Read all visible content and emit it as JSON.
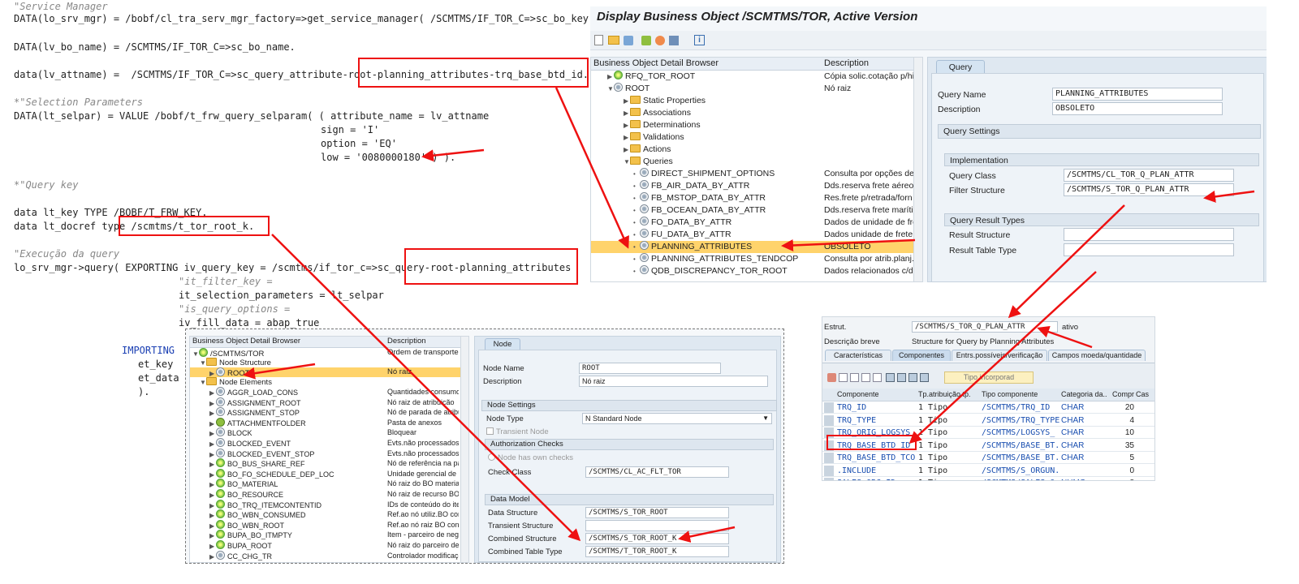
{
  "code": {
    "lines": [
      "\"Service Manager",
      "DATA(lo_srv_mgr) = /bobf/cl_tra_serv_mgr_factory=>get_service_manager( /SCMTMS/IF_TOR_C=>sc_bo_key ).",
      "DATA(lv_bo_name) = /SCMTMS/IF_TOR_C=>sc_bo_name.",
      "data(lv_attname) =  /SCMTMS/IF_TOR_C=>sc_query_attribute-root-planning_attributes-trq_base_btd_id.",
      "*\"Selection Parameters",
      "DATA(lt_selpar) = VALUE /bobf/t_frw_query_selparam( ( attribute_name = lv_attname",
      "sign = 'I'",
      "option = 'EQ'",
      "low = '0080000180' ) ).",
      "*\"Query key",
      "data lt_key TYPE /BOBF/T_FRW_KEY.",
      "data lt_docref type /scmtms/t_tor_root_k.",
      "\"Execução da query",
      "lo_srv_mgr->query( EXPORTING iv_query_key = /scmtms/if_tor_c=>sc_query-root-planning_attributes",
      "\"it_filter_key =",
      "it_selection_parameters = lt_selpar",
      "\"is_query_options =",
      "iv_fill_data = abap_true",
      "IMPORTING",
      "et_key",
      "et_data",
      ")."
    ]
  },
  "bo_window": {
    "title": "Display Business Object /SCMTMS/TOR, Active Version",
    "browser_header": "Business Object Detail Browser",
    "desc_header": "Description",
    "rows": [
      {
        "name": "RFQ_TOR_ROOT",
        "desc": "Cópia solic.cotação p/hier",
        "icon": "o"
      },
      {
        "name": "ROOT",
        "desc": "Nó raiz",
        "icon": "c"
      },
      {
        "name": "Static Properties",
        "desc": "",
        "icon": "f"
      },
      {
        "name": "Associations",
        "desc": "",
        "icon": "f"
      },
      {
        "name": "Determinations",
        "desc": "",
        "icon": "f"
      },
      {
        "name": "Validations",
        "desc": "",
        "icon": "f"
      },
      {
        "name": "Actions",
        "desc": "",
        "icon": "f"
      },
      {
        "name": "Queries",
        "desc": "",
        "icon": "f"
      },
      {
        "name": "DIRECT_SHIPMENT_OPTIONS",
        "desc": "Consulta por opções de r",
        "icon": "c"
      },
      {
        "name": "FB_AIR_DATA_BY_ATTR",
        "desc": "Dds.reserva frete aéreo p",
        "icon": "c"
      },
      {
        "name": "FB_MSTOP_DATA_BY_ATTR",
        "desc": "Res.frete p/retrada/forn",
        "icon": "c"
      },
      {
        "name": "FB_OCEAN_DATA_BY_ATTR",
        "desc": "Dds.reserva frete marítim",
        "icon": "c"
      },
      {
        "name": "FO_DATA_BY_ATTR",
        "desc": "Dados de unidade de fret",
        "icon": "c"
      },
      {
        "name": "FU_DATA_BY_ATTR",
        "desc": "Dados unidade de frete p",
        "icon": "c"
      },
      {
        "name": "PLANNING_ATTRIBUTES",
        "desc": "OBSOLETO",
        "icon": "c"
      },
      {
        "name": "PLANNING_ATTRIBUTES_TENDCOP",
        "desc": "Consulta por atrib.planj.-",
        "icon": "c"
      },
      {
        "name": "QDB_DISCREPANCY_TOR_ROOT",
        "desc": "Dados relacionados c/des",
        "icon": "c"
      }
    ],
    "tab": "Query",
    "query_name_label": "Query Name",
    "query_name_value": "PLANNING_ATTRIBUTES",
    "description_label": "Description",
    "description_value": "OBSOLETO",
    "settings_title": "Query Settings",
    "impl_title": "Implementation",
    "query_class_label": "Query Class",
    "query_class_value": "/SCMTMS/CL_TOR_Q_PLAN_ATTR",
    "filter_label": "Filter Structure",
    "filter_value": "/SCMTMS/S_TOR_Q_PLAN_ATTR",
    "result_title": "Query Result Types",
    "result_struct_label": "Result Structure",
    "result_table_label": "Result Table Type"
  },
  "node_window": {
    "browser_header": "Business Object Detail Browser",
    "desc_header": "Description",
    "root_label": "/SCMTMS/TOR",
    "root_desc": "Ordem de transporte",
    "node_structure": "Node Structure",
    "node_elements": "Node Elements",
    "rows": [
      {
        "name": "AGGR_LOAD_CONS",
        "desc": "Quantidades consumo ca",
        "icon": "c"
      },
      {
        "name": "ASSIGNMENT_ROOT",
        "desc": "Nó raiz de atribuição",
        "icon": "c"
      },
      {
        "name": "ASSIGNMENT_STOP",
        "desc": "Nó de parada de atribuiç",
        "icon": "c"
      },
      {
        "name": "ATTACHMENTFOLDER",
        "desc": "Pasta de anexos",
        "icon": "g"
      },
      {
        "name": "BLOCK",
        "desc": "Bloquear",
        "icon": "c"
      },
      {
        "name": "BLOCKED_EVENT",
        "desc": "Evts.não processados blo",
        "icon": "c"
      },
      {
        "name": "BLOCKED_EVENT_STOP",
        "desc": "Evts.não processados blo",
        "icon": "c"
      },
      {
        "name": "BO_BUS_SHARE_REF",
        "desc": "Nó de referência na parti",
        "icon": "o"
      },
      {
        "name": "BO_FO_SCHEDULE_DEP_LOC",
        "desc": "Unidade gerencial de part",
        "icon": "o"
      },
      {
        "name": "BO_MATERIAL",
        "desc": "Nó raiz do BO material",
        "icon": "o"
      },
      {
        "name": "BO_RESOURCE",
        "desc": "Nó raiz de recurso BO",
        "icon": "o"
      },
      {
        "name": "BO_TRQ_ITEMCONTENTID",
        "desc": "IDs de conteúdo do item",
        "icon": "o"
      },
      {
        "name": "BO_WBN_CONSUMED",
        "desc": "Ref.ao nó utiliz.BO conhe",
        "icon": "o"
      },
      {
        "name": "BO_WBN_ROOT",
        "desc": "Ref.ao nó raiz BO conhec",
        "icon": "o"
      },
      {
        "name": "BUPA_BO_ITMPTY",
        "desc": "Item - parceiro de negóc",
        "icon": "o"
      },
      {
        "name": "BUPA_ROOT",
        "desc": "Nó raiz do parceiro de ne",
        "icon": "o"
      },
      {
        "name": "CC_CHG_TR",
        "desc": "Controlador modificações",
        "icon": "c"
      }
    ],
    "root_node": "ROOT",
    "root_node_desc": "Nó raiz",
    "tab": "Node",
    "node_name_label": "Node Name",
    "node_name_value": "ROOT",
    "description_label": "Description",
    "description_value": "Nó raiz",
    "settings_title": "Node Settings",
    "node_type_label": "Node Type",
    "node_type_value": "N Standard Node",
    "transient_label": "Transient Node",
    "auth_title": "Authorization Checks",
    "own_checks_label": "Node has own checks",
    "check_class_label": "Check Class",
    "check_class_value": "/SCMTMS/CL_AC_FLT_TOR",
    "model_title": "Data Model",
    "data_struct_label": "Data Structure",
    "data_struct_value": "/SCMTMS/S_TOR_ROOT",
    "transient_struct_label": "Transient Structure",
    "combined_struct_label": "Combined Structure",
    "combined_struct_value": "/SCMTMS/S_TOR_ROOT_K",
    "combined_table_label": "Combined Table Type",
    "combined_table_value": "/SCMTMS/T_TOR_ROOT_K"
  },
  "struct_window": {
    "estrut_label": "Estrut.",
    "estrut_value": "/SCMTMS/S_TOR_Q_PLAN_ATTR",
    "status": "ativo",
    "desc_label": "Descrição breve",
    "desc_value": "Structure for Query by Planning Attributes",
    "tabs": [
      "Características",
      "Componentes",
      "Entrs.possíveis/verificação",
      "Campos moeda/quantidade"
    ],
    "tipo_button": "Tipo incorporad",
    "columns": [
      "Componente",
      "Tp.atribuição tp.",
      "Tipo componente",
      "Categoria da...",
      "Compr",
      "Cas"
    ],
    "rows": [
      [
        "TRQ_ID",
        "1 Tipo",
        "/SCMTMS/TRQ_ID",
        "CHAR",
        "20"
      ],
      [
        "TRQ_TYPE",
        "1 Tipo",
        "/SCMTMS/TRQ_TYPE",
        "CHAR",
        "4"
      ],
      [
        "TRQ_ORIG_LOGSYS",
        "1 Tipo",
        "/SCMTMS/LOGSYS_",
        "CHAR",
        "10"
      ],
      [
        "TRQ_BASE_BTD_ID",
        "1 Tipo",
        "/SCMTMS/BASE_BT.",
        "CHAR",
        "35"
      ],
      [
        "TRQ_BASE_BTD_TCO",
        "1 Tipo",
        "/SCMTMS/BASE_BT.",
        "CHAR",
        "5"
      ],
      [
        ".INCLUDE",
        "1 Tipo",
        "/SCMTMS/S_ORGUN.",
        "",
        "0"
      ],
      [
        "SALES_ORG_ID",
        "1 Tipo",
        "/SCMTMS/SALES_O.",
        "NUMC",
        "8"
      ]
    ]
  },
  "colors": {
    "accent": "#e11",
    "highlight": "#ffd36b",
    "panel": "#eef3f8"
  }
}
